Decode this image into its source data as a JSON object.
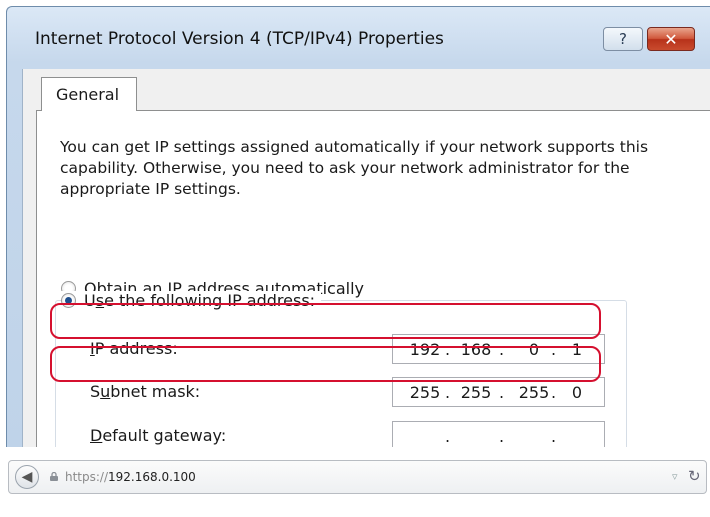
{
  "dialog": {
    "title": "Internet Protocol Version 4 (TCP/IPv4) Properties",
    "help_button": "?",
    "close_button": "✕",
    "tab_label": "General",
    "description": "You can get IP settings assigned automatically if your network supports this capability. Otherwise, you need to ask your network administrator for the appropriate IP settings.",
    "radio_auto": {
      "prefix": "",
      "key": "O",
      "rest": "btain an IP address automatically",
      "selected": false
    },
    "radio_manual": {
      "prefix": "U",
      "key": "s",
      "rest": "e the following IP address:",
      "selected": true
    },
    "fields": [
      {
        "prefix": "",
        "key": "I",
        "rest": "P address:",
        "octets": [
          "192",
          "168",
          "0",
          "1"
        ],
        "highlighted": true
      },
      {
        "prefix": "S",
        "key": "u",
        "rest": "bnet mask:",
        "octets": [
          "255",
          "255",
          "255",
          "0"
        ],
        "highlighted": true
      },
      {
        "prefix": "",
        "key": "D",
        "rest": "efault gateway:",
        "octets": [
          "",
          "",
          "",
          ""
        ],
        "highlighted": false
      }
    ],
    "highlight_color": "#d5102f"
  },
  "browser": {
    "back_icon": "back-arrow-icon",
    "url_protocol": "https://",
    "url_host": "192.168.0.100",
    "dropdown_icon": "▿",
    "reload_icon": "↻"
  }
}
